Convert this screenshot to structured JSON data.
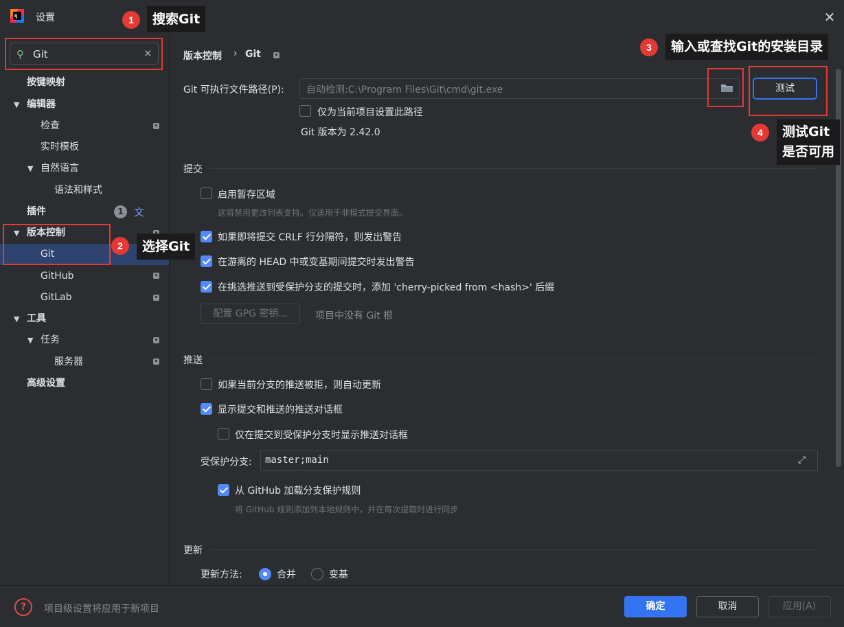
{
  "window": {
    "title": "设置",
    "close_glyph": "✕"
  },
  "search": {
    "value": "Git",
    "clear_glyph": "✕"
  },
  "sidebar": {
    "keymap": "按键映射",
    "editor": "编辑器",
    "inspections": "检查",
    "live_templates": "实时模板",
    "natural_languages": "自然语言",
    "grammar_style": "语法和样式",
    "plugins": "插件",
    "plugins_badge": "1",
    "vcs": "版本控制",
    "git": "Git",
    "github": "GitHub",
    "gitlab": "GitLab",
    "tools": "工具",
    "tasks": "任务",
    "servers": "服务器",
    "advanced": "高级设置"
  },
  "breadcrumb": {
    "parent": "版本控制",
    "separator": "›",
    "current": "Git"
  },
  "git_path": {
    "label": "Git 可执行文件路径(P):",
    "value": "自动检测:C:\\Program Files\\Git\\cmd\\git.exe",
    "test_button": "测试",
    "project_only_label": "仅为当前项目设置此路径",
    "version_text": "Git 版本为 2.42.0"
  },
  "commit": {
    "title": "提交",
    "staging_label": "启用暂存区域",
    "staging_hint": "这将禁用更改列表支持。仅适用于非模式提交界面。",
    "crlf_label": "如果即将提交 CRLF 行分隔符，则发出警告",
    "detached_label": "在游离的 HEAD 中或变基期间提交时发出警告",
    "cherry_pick_label": "在挑选推送到受保护分支的提交时，添加 'cherry-picked from <hash>' 后缀",
    "gpg_button": "配置 GPG 密钥...",
    "gpg_hint": "项目中没有 Git 根"
  },
  "push": {
    "title": "推送",
    "auto_update_label": "如果当前分支的推送被拒，则自动更新",
    "show_dialog_label": "显示提交和推送的推送对话框",
    "protected_only_label": "仅在提交到受保护分支时显示推送对话框",
    "protected_branches_label": "受保护分支:",
    "protected_branches_value": "master;main",
    "github_rules_label": "从 GitHub 加载分支保护规则",
    "github_rules_hint": "将 GitHub 规则添加到本地规则中，并在每次提取时进行同步"
  },
  "update": {
    "title": "更新",
    "method_label": "更新方法:",
    "merge_label": "合并",
    "rebase_label": "变基"
  },
  "checkbox_state": {
    "project_only": false,
    "staging": false,
    "crlf": true,
    "detached": true,
    "cherry_pick": true,
    "auto_update": false,
    "show_dialog": true,
    "protected_only": false,
    "github_rules": true
  },
  "footer": {
    "hint": "项目级设置将应用于新项目",
    "ok": "确定",
    "cancel": "取消",
    "apply": "应用(A)"
  },
  "annotations": {
    "step1_num": "1",
    "step1_text": "搜索Git",
    "step2_num": "2",
    "step2_text": "选择Git",
    "step3_num": "3",
    "step3_text": "输入或查找Git的安装目录",
    "step4_num": "4",
    "step4_line1": "测试Git",
    "step4_line2": "是否可用"
  },
  "colors": {
    "accent": "#3574f0",
    "annotation_red": "#e53935",
    "selection": "#2e436e"
  }
}
